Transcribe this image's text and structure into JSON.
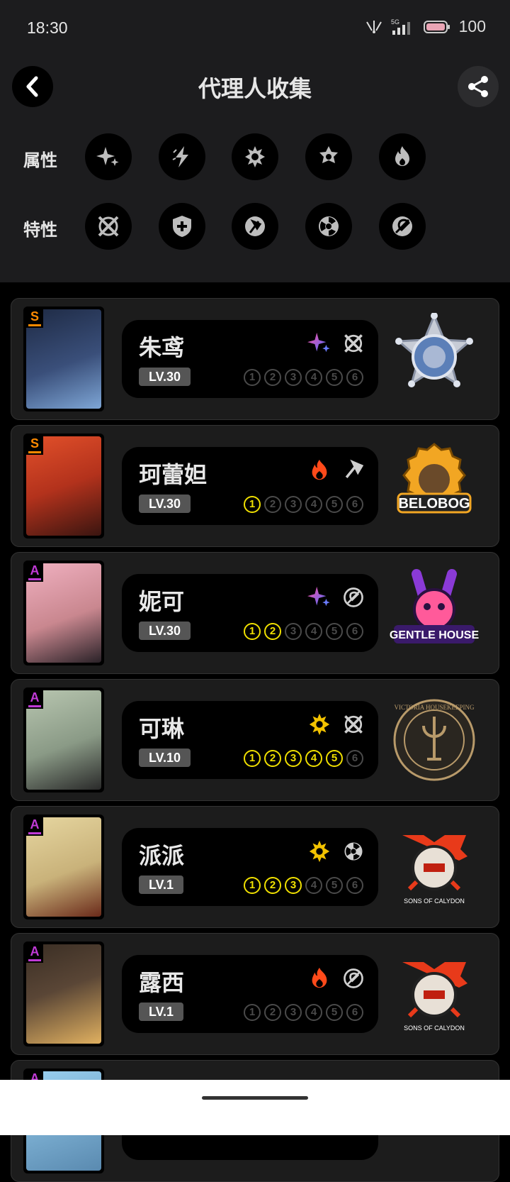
{
  "status_bar": {
    "time": "18:30",
    "network": "5G",
    "battery": "100"
  },
  "header": {
    "title": "代理人收集"
  },
  "filters": {
    "attribute_label": "属性",
    "attribute_icons": [
      "ether-icon",
      "electric-icon",
      "physical-icon",
      "ice-icon",
      "fire-icon"
    ],
    "specialty_label": "特性",
    "specialty_icons": [
      "attack-icon",
      "defense-icon",
      "stun-icon",
      "anomaly-icon",
      "support-icon"
    ]
  },
  "agents": [
    {
      "name": "朱鸢",
      "level": "LV.30",
      "rank": "S",
      "element": "ether",
      "specialty": "attack",
      "mindscape_unlocked": 0,
      "faction": "criminal-investigation-badge",
      "portrait_color": "#3a4f7a"
    },
    {
      "name": "珂蕾妲",
      "level": "LV.30",
      "rank": "S",
      "element": "fire",
      "specialty": "stun",
      "mindscape_unlocked": 1,
      "faction": "BELOBOG",
      "portrait_color": "#b3321c"
    },
    {
      "name": "妮可",
      "level": "LV.30",
      "rank": "A",
      "element": "ether",
      "specialty": "support",
      "mindscape_unlocked": 2,
      "faction": "GENTLE HOUSE",
      "portrait_color": "#c9878f"
    },
    {
      "name": "可琳",
      "level": "LV.10",
      "rank": "A",
      "element": "physical",
      "specialty": "attack",
      "mindscape_unlocked": 5,
      "faction": "VICTORIA HOUSEKEEPING",
      "portrait_color": "#8a9a86"
    },
    {
      "name": "派派",
      "level": "LV.1",
      "rank": "A",
      "element": "physical",
      "specialty": "anomaly",
      "mindscape_unlocked": 3,
      "faction": "SONS OF CALYDON",
      "portrait_color": "#c9b27a"
    },
    {
      "name": "露西",
      "level": "LV.1",
      "rank": "A",
      "element": "fire",
      "specialty": "support",
      "mindscape_unlocked": 0,
      "faction": "SONS OF CALYDON",
      "portrait_color": "#5a4636"
    }
  ],
  "mindscape_numbers": [
    "1",
    "2",
    "3",
    "4",
    "5",
    "6"
  ],
  "colors": {
    "s_rank": "#ff8a00",
    "a_rank": "#c03ad6",
    "mindscape_on": "#f0e000",
    "card_bg": "#1c1c1c"
  }
}
